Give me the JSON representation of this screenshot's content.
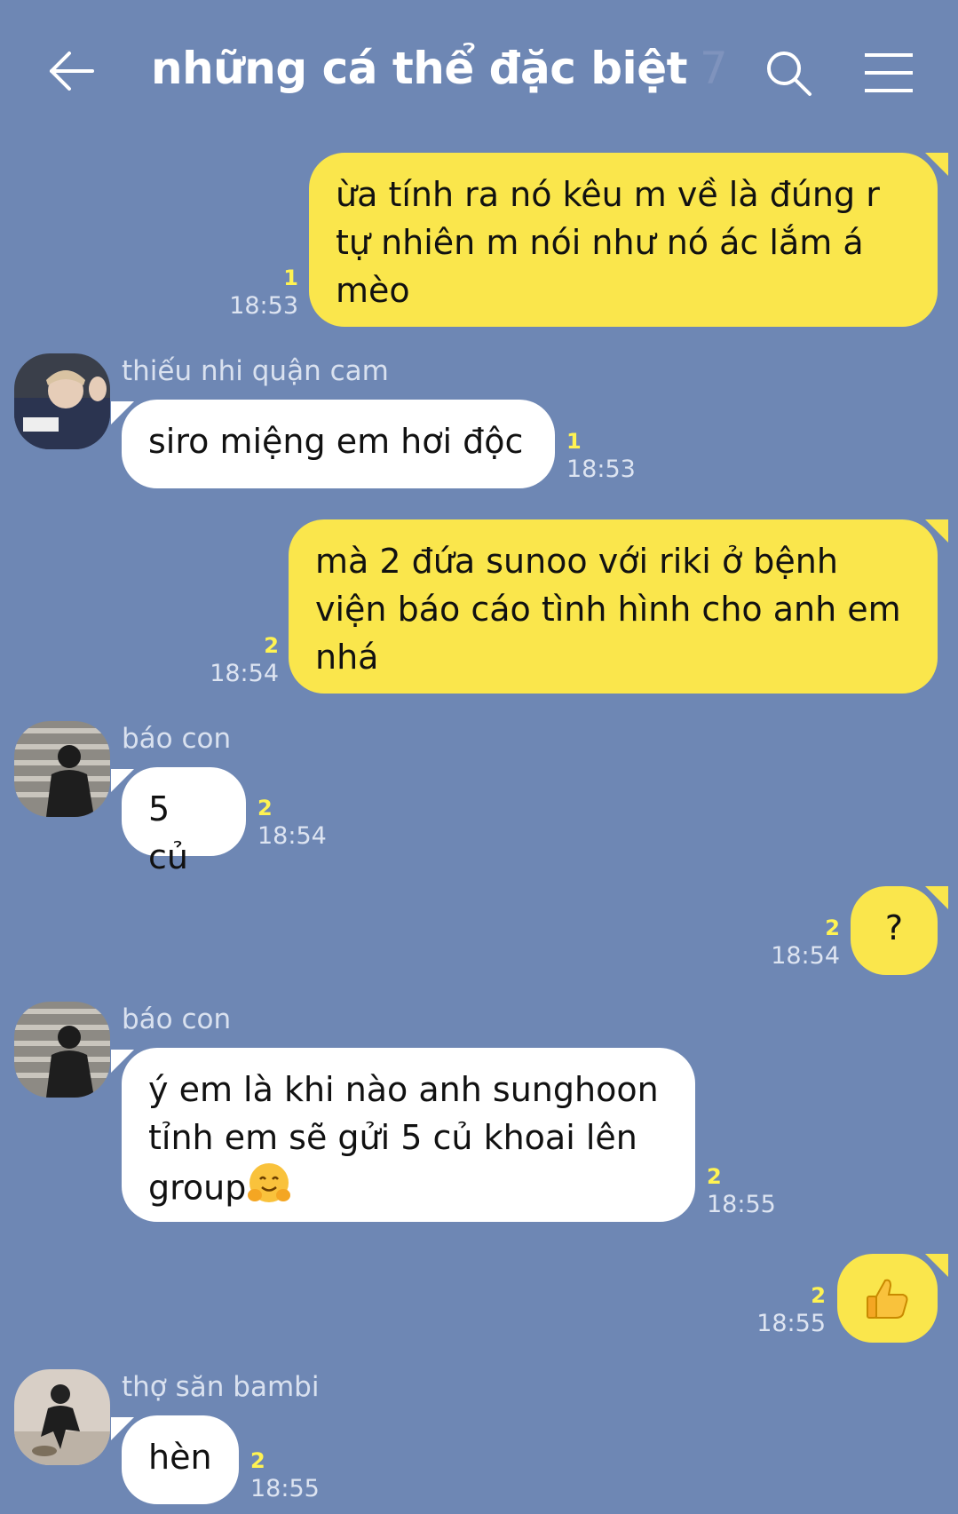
{
  "header": {
    "title": "những cá thể đặc biệt",
    "member_count": "7"
  },
  "colors": {
    "background": "#6e87b4",
    "outgoing_bubble": "#fae64c",
    "incoming_bubble": "#ffffff",
    "unread": "#fff352"
  },
  "messages": [
    {
      "direction": "out",
      "text_lines": [
        "ừa tính ra nó kêu m về là đúng r",
        "tự nhiên m nói như nó ác lắm á",
        "mèo"
      ],
      "unread": "1",
      "time": "18:53"
    },
    {
      "direction": "in",
      "sender": "thiếu nhi quận cam",
      "text": "siro miệng em hơi độc",
      "unread": "1",
      "time": "18:53"
    },
    {
      "direction": "out",
      "text_lines": [
        "mà 2 đứa sunoo với riki ở bệnh",
        "viện báo cáo tình hình cho anh em",
        "nhá"
      ],
      "unread": "2",
      "time": "18:54"
    },
    {
      "direction": "in",
      "sender": "báo con",
      "text": "5 củ",
      "unread": "2",
      "time": "18:54"
    },
    {
      "direction": "out",
      "text": "?",
      "unread": "2",
      "time": "18:54"
    },
    {
      "direction": "in",
      "sender": "báo con",
      "text_lines": [
        "ý em là khi nào anh sunghoon",
        "tỉnh em sẽ gửi 5 củ khoai lên",
        "group"
      ],
      "emoji": "hugging-face-emoji",
      "unread": "2",
      "time": "18:55"
    },
    {
      "direction": "out",
      "emoji": "thumbs-up-emoji",
      "unread": "2",
      "time": "18:55"
    },
    {
      "direction": "in",
      "sender": "thợ săn bambi",
      "text": "hèn",
      "unread": "2",
      "time": "18:55"
    }
  ]
}
